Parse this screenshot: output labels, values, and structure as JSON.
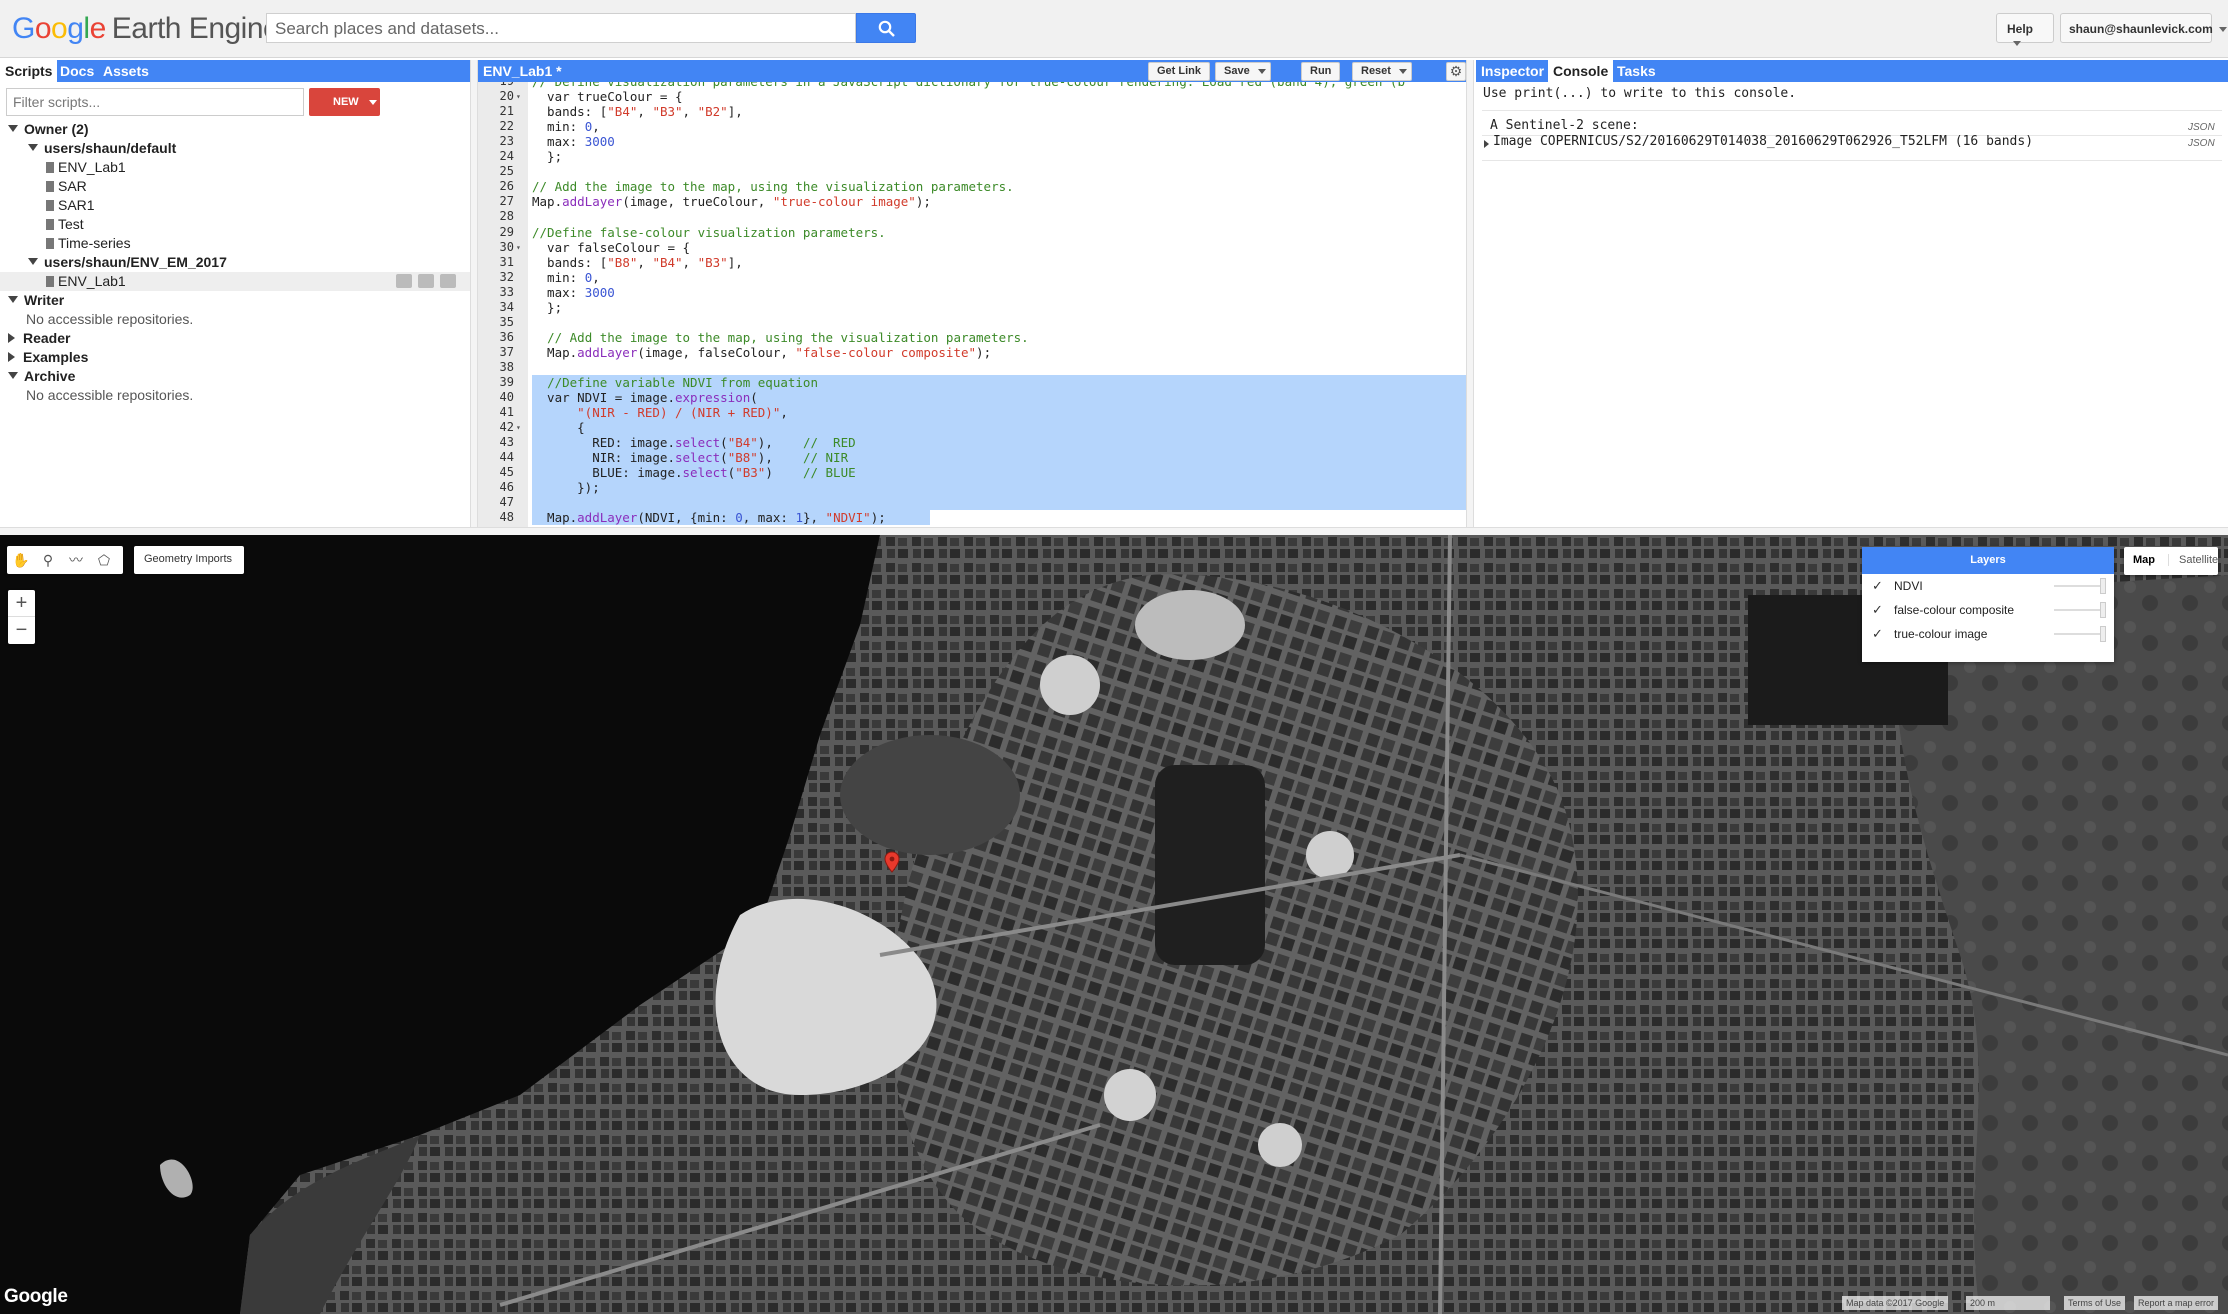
{
  "app": {
    "logo_google": [
      "G",
      "o",
      "o",
      "g",
      "l",
      "e"
    ],
    "logo_colors": [
      "#4285f4",
      "#ea4335",
      "#fbbc05",
      "#4285f4",
      "#34a853",
      "#ea4335"
    ],
    "logo_product": "Earth Engine",
    "search_placeholder": "Search places and datasets...",
    "help_label": "Help",
    "user_label": "shaun@shaunlevick.com"
  },
  "left_panel": {
    "tabs": [
      "Scripts",
      "Docs",
      "Assets"
    ],
    "active_tab": "Scripts",
    "filter_placeholder": "Filter scripts...",
    "new_label": "NEW",
    "tree": [
      {
        "label": "Owner  (2)",
        "type": "group",
        "expanded": true
      },
      {
        "label": "users/shaun/default",
        "type": "repo",
        "expanded": true
      },
      {
        "label": "ENV_Lab1",
        "type": "file"
      },
      {
        "label": "SAR",
        "type": "file"
      },
      {
        "label": "SAR1",
        "type": "file"
      },
      {
        "label": "Test",
        "type": "file"
      },
      {
        "label": "Time-series",
        "type": "file"
      },
      {
        "label": "users/shaun/ENV_EM_2017",
        "type": "repo",
        "expanded": true
      },
      {
        "label": "ENV_Lab1",
        "type": "file",
        "selected": true
      },
      {
        "label": "Writer",
        "type": "group",
        "expanded": true
      },
      {
        "label": "No accessible repositories.",
        "type": "note"
      },
      {
        "label": "Reader",
        "type": "group",
        "expanded": false
      },
      {
        "label": "Examples",
        "type": "group",
        "expanded": false
      },
      {
        "label": "Archive",
        "type": "group",
        "expanded": true
      },
      {
        "label": "No accessible repositories.",
        "type": "note"
      }
    ]
  },
  "editor": {
    "title": "ENV_Lab1 *",
    "buttons": {
      "get_link": "Get Link",
      "save": "Save",
      "run": "Run",
      "reset": "Reset"
    },
    "lines": [
      {
        "n": "19",
        "text": "// Define visualization parameters in a JavaScript dictionary for true-colour rendering. Load red (band 4), green (b"
      },
      {
        "n": "20",
        "text": "  var trueColour = {"
      },
      {
        "n": "21",
        "text": "  bands: [\"B4\", \"B3\", \"B2\"],"
      },
      {
        "n": "22",
        "text": "  min: 0,"
      },
      {
        "n": "23",
        "text": "  max: 3000"
      },
      {
        "n": "24",
        "text": "  };"
      },
      {
        "n": "25",
        "text": ""
      },
      {
        "n": "26",
        "text": "// Add the image to the map, using the visualization parameters."
      },
      {
        "n": "27",
        "text": "Map.addLayer(image, trueColour, \"true-colour image\");"
      },
      {
        "n": "28",
        "text": ""
      },
      {
        "n": "29",
        "text": "//Define false-colour visualization parameters."
      },
      {
        "n": "30",
        "text": "  var falseColour = {"
      },
      {
        "n": "31",
        "text": "  bands: [\"B8\", \"B4\", \"B3\"],"
      },
      {
        "n": "32",
        "text": "  min: 0,"
      },
      {
        "n": "33",
        "text": "  max: 3000"
      },
      {
        "n": "34",
        "text": "  };"
      },
      {
        "n": "35",
        "text": ""
      },
      {
        "n": "36",
        "text": "  // Add the image to the map, using the visualization parameters."
      },
      {
        "n": "37",
        "text": "  Map.addLayer(image, falseColour, \"false-colour composite\");"
      },
      {
        "n": "38",
        "text": ""
      },
      {
        "n": "39",
        "text": "  //Define variable NDVI from equation"
      },
      {
        "n": "40",
        "text": "  var NDVI = image.expression("
      },
      {
        "n": "41",
        "text": "      \"(NIR - RED) / (NIR + RED)\","
      },
      {
        "n": "42",
        "text": "      {"
      },
      {
        "n": "43",
        "text": "        RED: image.select(\"B4\"),    //  RED"
      },
      {
        "n": "44",
        "text": "        NIR: image.select(\"B8\"),    // NIR"
      },
      {
        "n": "45",
        "text": "        BLUE: image.select(\"B3\")    // BLUE"
      },
      {
        "n": "46",
        "text": "      });"
      },
      {
        "n": "47",
        "text": ""
      },
      {
        "n": "48",
        "text": "  Map.addLayer(NDVI, {min: 0, max: 1}, \"NDVI\");"
      }
    ]
  },
  "right_panel": {
    "tabs": [
      "Inspector",
      "Console",
      "Tasks"
    ],
    "active_tab": "Console",
    "hint": "Use print(...) to write to this console.",
    "entries": [
      {
        "text": "A Sentinel-2 scene:",
        "tag": "JSON"
      },
      {
        "text": "Image COPERNICUS/S2/20160629T014038_20160629T062926_T52LFM (16 bands)",
        "tag": "JSON"
      }
    ]
  },
  "map": {
    "geometry_imports": "Geometry Imports",
    "zoom_in": "+",
    "zoom_out": "−",
    "layers_title": "Layers",
    "layers": [
      "NDVI",
      "false-colour composite",
      "true-colour image"
    ],
    "map_type": {
      "map": "Map",
      "satellite": "Satellite"
    },
    "google_mark": "Google",
    "attribution": {
      "data": "Map data ©2017 Google",
      "scale": "200 m",
      "terms": "Terms of Use",
      "report": "Report a map error"
    },
    "icons": [
      "hand-icon",
      "marker-icon",
      "line-icon",
      "polygon-icon",
      "map-pin-icon"
    ]
  }
}
